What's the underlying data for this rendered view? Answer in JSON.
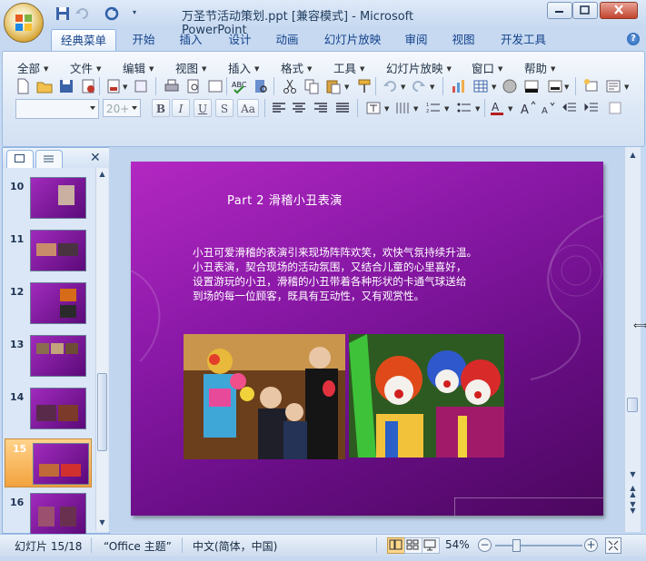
{
  "window": {
    "title": "万圣节活动策划.ppt [兼容模式] - Microsoft PowerPoint"
  },
  "ribbon_tabs": [
    "经典菜单",
    "开始",
    "插入",
    "设计",
    "动画",
    "幻灯片放映",
    "审阅",
    "视图",
    "开发工具"
  ],
  "classic_menus": [
    "全部",
    "文件",
    "编辑",
    "视图",
    "插入",
    "格式",
    "工具",
    "幻灯片放映",
    "窗口",
    "帮助"
  ],
  "font": {
    "name_value": "",
    "size_value": "20+"
  },
  "format_buttons": [
    "B",
    "I",
    "U",
    "S",
    "Aa"
  ],
  "slide_panel": {
    "thumbnails": [
      {
        "number": "10"
      },
      {
        "number": "11"
      },
      {
        "number": "12"
      },
      {
        "number": "13"
      },
      {
        "number": "14"
      },
      {
        "number": "15",
        "selected": true
      },
      {
        "number": "16"
      }
    ]
  },
  "slide": {
    "title": "Part 2  滑稽小丑表演",
    "body_lines": [
      "小丑可爱滑稽的表演引来现场阵阵欢笑，欢快气氛持续升温。",
      "小丑表演，契合现场的活动氛围，又结合儿童的心里喜好，",
      "设置游玩的小丑，滑稽的小丑带着各种形状的卡通气球送给",
      "到场的每一位顾客，既具有互动性，又有观赏性。"
    ],
    "background_colors": [
      "#b328c2",
      "#4b075e"
    ]
  },
  "status_bar": {
    "slide_position": "幻灯片 15/18",
    "theme": "“Office 主题”",
    "language": "中文(简体，中国)",
    "zoom": "54%"
  }
}
